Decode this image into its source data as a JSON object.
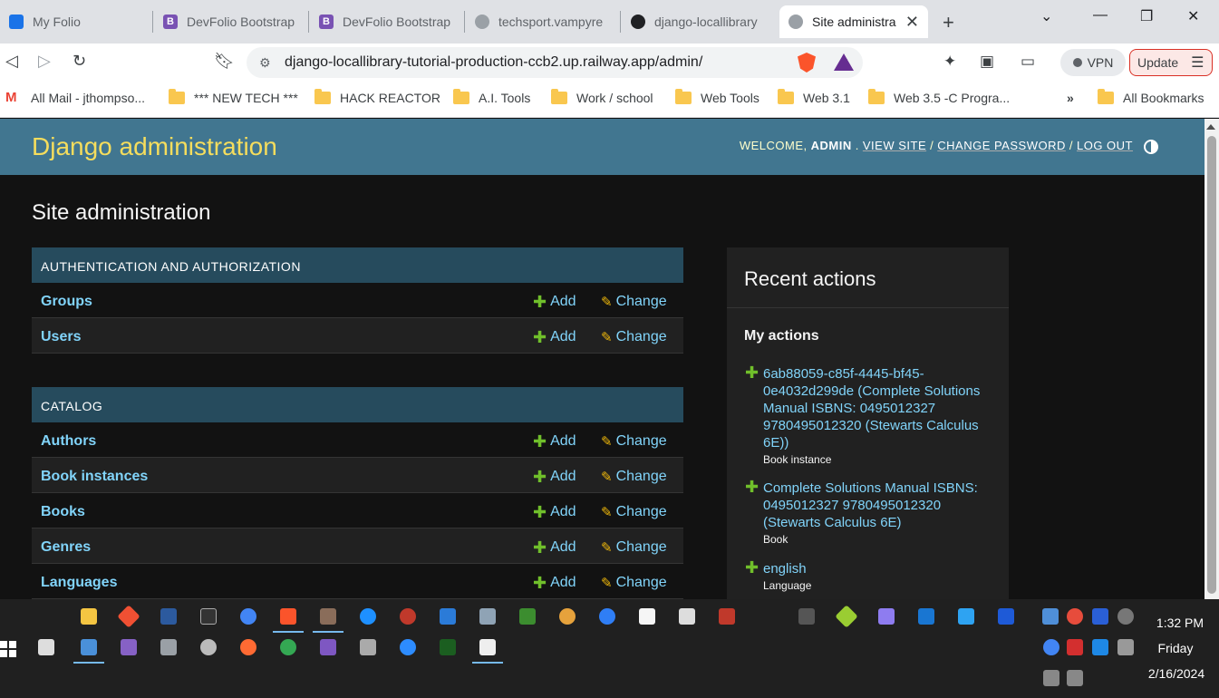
{
  "browser": {
    "tabs": [
      {
        "label": "My Folio",
        "active": false
      },
      {
        "label": "DevFolio Bootstrap",
        "active": false
      },
      {
        "label": "DevFolio Bootstrap",
        "active": false
      },
      {
        "label": "techsport.vampyre",
        "active": false
      },
      {
        "label": "django-locallibrary",
        "active": false
      },
      {
        "label": "Site administra",
        "active": true
      }
    ],
    "url": "django-locallibrary-tutorial-production-ccb2.up.railway.app/admin/",
    "vpn_label": "VPN",
    "update_label": "Update",
    "bookmarks": [
      {
        "label": "All Mail - jthompso...",
        "icon": "gmail-icon"
      },
      {
        "label": "*** NEW TECH ***",
        "icon": "folder-icon"
      },
      {
        "label": "HACK REACTOR",
        "icon": "folder-icon"
      },
      {
        "label": "A.I. Tools",
        "icon": "folder-icon"
      },
      {
        "label": "Work / school",
        "icon": "folder-icon"
      },
      {
        "label": "Web Tools",
        "icon": "folder-icon"
      },
      {
        "label": "Web 3.1",
        "icon": "folder-icon"
      },
      {
        "label": "Web 3.5  -C Progra...",
        "icon": "folder-icon"
      }
    ],
    "bookmarks_overflow": "»",
    "all_bookmarks": "All Bookmarks"
  },
  "admin": {
    "branding": "Django administration",
    "welcome": "WELCOME,",
    "username": "ADMIN",
    "view_site": "VIEW SITE",
    "change_password": "CHANGE PASSWORD",
    "log_out": "LOG OUT",
    "sep": "/",
    "title": "Site administration",
    "add_label": "Add",
    "change_label": "Change",
    "modules": [
      {
        "caption": "AUTHENTICATION AND AUTHORIZATION",
        "models": [
          "Groups",
          "Users"
        ]
      },
      {
        "caption": "CATALOG",
        "models": [
          "Authors",
          "Book instances",
          "Books",
          "Genres",
          "Languages"
        ]
      }
    ],
    "recent": {
      "heading": "Recent actions",
      "subheading": "My actions",
      "items": [
        {
          "text": "6ab88059-c85f-4445-bf45-0e4032d299de (Complete Solutions Manual ISBNS: 0495012327 9780495012320 (Stewarts Calculus 6E))",
          "type": "Book instance"
        },
        {
          "text": "Complete Solutions Manual ISBNS: 0495012327 9780495012320 (Stewarts Calculus 6E)",
          "type": "Book"
        },
        {
          "text": "english",
          "type": "Language"
        }
      ]
    }
  },
  "taskbar": {
    "time": "1:32 PM",
    "day": "Friday",
    "date": "2/16/2024"
  },
  "colors": {
    "header_bg": "#417690",
    "branding": "#f5dd5d",
    "caption_bg": "#264b5d",
    "link": "#81d4fa",
    "add_icon": "#70bf2b",
    "change_icon": "#efb80b"
  }
}
